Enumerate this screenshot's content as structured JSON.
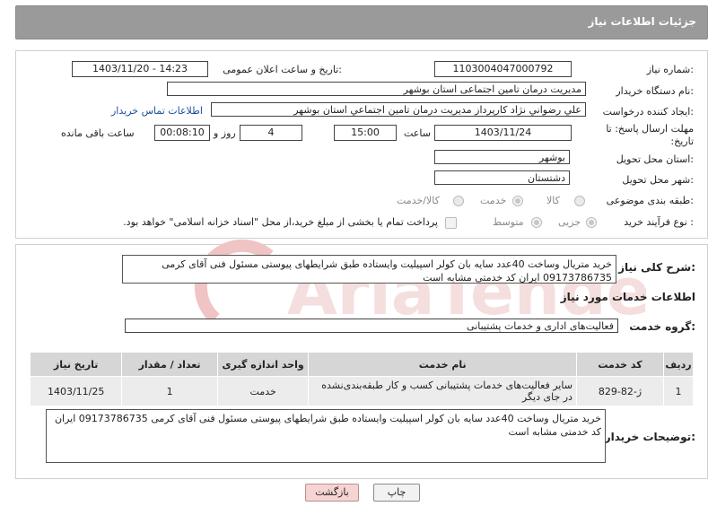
{
  "header": {
    "title": "جزئیات اطلاعات نیاز"
  },
  "fields": {
    "need_number_label": "شماره نیاز:",
    "need_number": "1103004047000792",
    "announce_label": "تاریخ و ساعت اعلان عمومی:",
    "announce_value": "1403/11/20 - 14:23",
    "buyer_org_label": "نام دستگاه خریدار:",
    "buyer_org": "مدیریت درمان تامین اجتماعی استان بوشهر",
    "creator_label": "ایجاد کننده درخواست:",
    "creator": "علي رضواني نژاد كارپرداز مديريت درمان تامين اجتماعي استان بوشهر",
    "contact_link": "اطلاعات تماس خریدار",
    "deadline_label": "مهلت ارسال پاسخ: تا تاریخ:",
    "deadline_date": "1403/11/24",
    "time_label": "ساعت",
    "deadline_time": "15:00",
    "days_value": "4",
    "days_label": "روز و",
    "remaining_time": "00:08:10",
    "remaining_label": "ساعت باقی مانده",
    "province_label": "استان محل تحویل:",
    "province": "بوشهر",
    "city_label": "شهر محل تحویل:",
    "city": "دشتستان",
    "category_label": "طبقه بندی موضوعی:",
    "category_options": [
      "کالا",
      "خدمت",
      "کالا/خدمت"
    ],
    "process_label": "نوع فرآیند خرید :",
    "process_options": [
      "جزیی",
      "متوسط"
    ],
    "payment_note": "پرداخت تمام یا بخشی از مبلغ خرید،از محل \"اسناد خزانه اسلامی\" خواهد بود."
  },
  "description": {
    "label": "شرح کلی نیاز:",
    "text": "خرید متریال وساخت 40عدد سایه بان کولر اسپیلیت وایستاده طبق شرایطهای پیوستی مسئول فنی آقای کرمی 09173786735 ایران کد خدمتی مشابه است"
  },
  "services": {
    "section_title": "اطلاعات خدمات مورد نیاز",
    "group_label": "گروه خدمت:",
    "group_value": "فعالیت‌های اداری و خدمات پشتیبانی",
    "columns": [
      "ردیف",
      "کد خدمت",
      "نام خدمت",
      "واحد اندازه گیری",
      "تعداد / مقدار",
      "تاریخ نیاز"
    ],
    "rows": [
      [
        "1",
        "ژ-82-829",
        "سایر فعالیت‌های خدمات پشتیبانی کسب و کار طبقه‌بندی‌نشده در جای دیگر",
        "خدمت",
        "1",
        "1403/11/25"
      ]
    ]
  },
  "buyer_notes": {
    "label": "توضیحات خریدار:",
    "text": "خرید متریال وساخت 40عدد سایه بان کولر اسپیلیت وایستاده طبق شرایطهای پیوستی مسئول فنی آقای کرمی 09173786735 ایران کد خدمتی مشابه است"
  },
  "buttons": {
    "print": "چاپ",
    "back": "بازگشت"
  },
  "watermark": "AriaTender.neT"
}
